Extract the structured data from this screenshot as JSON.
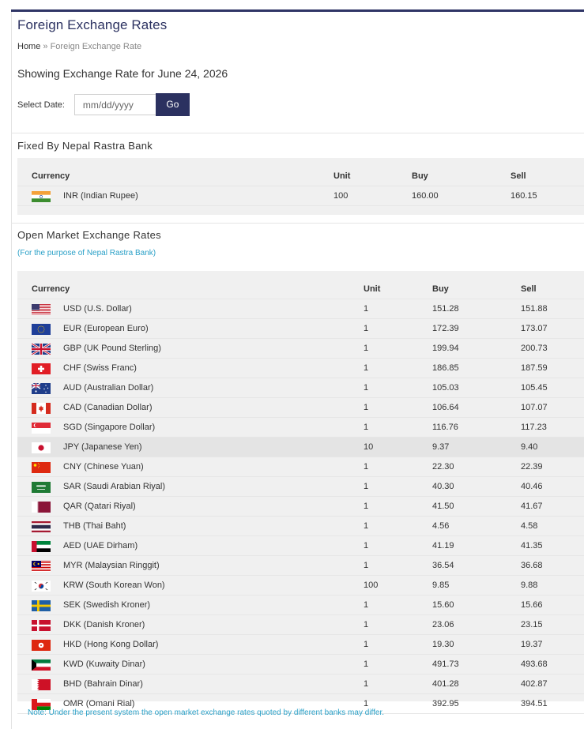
{
  "page": {
    "title": "Foreign Exchange Rates",
    "breadcrumb_home": "Home",
    "breadcrumb_sep": " » ",
    "breadcrumb_current": "Foreign Exchange Rate",
    "showing": "Showing Exchange Rate for June 24, 2026",
    "select_date_label": "Select Date:",
    "date_placeholder": "mm/dd/yyyy",
    "go_label": "Go"
  },
  "fixed": {
    "title": "Fixed By Nepal Rastra Bank",
    "headers": {
      "currency": "Currency",
      "unit": "Unit",
      "buy": "Buy",
      "sell": "Sell"
    },
    "rows": [
      {
        "flag": "india-flag-icon",
        "currency": "INR (Indian Rupee)",
        "unit": "100",
        "buy": "160.00",
        "sell": "160.15"
      }
    ]
  },
  "open": {
    "title": "Open Market Exchange Rates",
    "subtitle": "(For the purpose of Nepal Rastra Bank)",
    "headers": {
      "currency": "Currency",
      "unit": "Unit",
      "buy": "Buy",
      "sell": "Sell"
    },
    "rows": [
      {
        "flag": "usa-flag-icon",
        "currency": "USD (U.S. Dollar)",
        "unit": "1",
        "buy": "151.28",
        "sell": "151.88"
      },
      {
        "flag": "eu-flag-icon",
        "currency": "EUR (European Euro)",
        "unit": "1",
        "buy": "172.39",
        "sell": "173.07"
      },
      {
        "flag": "uk-flag-icon",
        "currency": "GBP (UK Pound Sterling)",
        "unit": "1",
        "buy": "199.94",
        "sell": "200.73"
      },
      {
        "flag": "switzerland-flag-icon",
        "currency": "CHF (Swiss Franc)",
        "unit": "1",
        "buy": "186.85",
        "sell": "187.59"
      },
      {
        "flag": "australia-flag-icon",
        "currency": "AUD (Australian Dollar)",
        "unit": "1",
        "buy": "105.03",
        "sell": "105.45"
      },
      {
        "flag": "canada-flag-icon",
        "currency": "CAD (Canadian Dollar)",
        "unit": "1",
        "buy": "106.64",
        "sell": "107.07"
      },
      {
        "flag": "singapore-flag-icon",
        "currency": "SGD (Singapore Dollar)",
        "unit": "1",
        "buy": "116.76",
        "sell": "117.23"
      },
      {
        "flag": "japan-flag-icon",
        "currency": "JPY (Japanese Yen)",
        "unit": "10",
        "buy": "9.37",
        "sell": "9.40",
        "highlight": true
      },
      {
        "flag": "china-flag-icon",
        "currency": "CNY (Chinese Yuan)",
        "unit": "1",
        "buy": "22.30",
        "sell": "22.39"
      },
      {
        "flag": "saudi-flag-icon",
        "currency": "SAR (Saudi Arabian Riyal)",
        "unit": "1",
        "buy": "40.30",
        "sell": "40.46"
      },
      {
        "flag": "qatar-flag-icon",
        "currency": "QAR (Qatari Riyal)",
        "unit": "1",
        "buy": "41.50",
        "sell": "41.67"
      },
      {
        "flag": "thailand-flag-icon",
        "currency": "THB (Thai Baht)",
        "unit": "1",
        "buy": "4.56",
        "sell": "4.58"
      },
      {
        "flag": "uae-flag-icon",
        "currency": "AED (UAE Dirham)",
        "unit": "1",
        "buy": "41.19",
        "sell": "41.35"
      },
      {
        "flag": "malaysia-flag-icon",
        "currency": "MYR (Malaysian Ringgit)",
        "unit": "1",
        "buy": "36.54",
        "sell": "36.68"
      },
      {
        "flag": "south-korea-flag-icon",
        "currency": "KRW (South Korean Won)",
        "unit": "100",
        "buy": "9.85",
        "sell": "9.88"
      },
      {
        "flag": "sweden-flag-icon",
        "currency": "SEK (Swedish Kroner)",
        "unit": "1",
        "buy": "15.60",
        "sell": "15.66"
      },
      {
        "flag": "denmark-flag-icon",
        "currency": "DKK (Danish Kroner)",
        "unit": "1",
        "buy": "23.06",
        "sell": "23.15"
      },
      {
        "flag": "hong-kong-flag-icon",
        "currency": "HKD (Hong Kong Dollar)",
        "unit": "1",
        "buy": "19.30",
        "sell": "19.37"
      },
      {
        "flag": "kuwait-flag-icon",
        "currency": "KWD (Kuwaity Dinar)",
        "unit": "1",
        "buy": "491.73",
        "sell": "493.68"
      },
      {
        "flag": "bahrain-flag-icon",
        "currency": "BHD (Bahrain Dinar)",
        "unit": "1",
        "buy": "401.28",
        "sell": "402.87"
      },
      {
        "flag": "oman-flag-icon",
        "currency": "OMR (Omani Rial)",
        "unit": "1",
        "buy": "392.95",
        "sell": "394.51"
      }
    ]
  },
  "note": "Note: Under the present system the open market exchange rates quoted by different banks may differ.",
  "colors": {
    "primary": "#2b3160",
    "accent_link": "#2aa0c7",
    "table_bg": "#f0f0f0",
    "highlight_row": "#e4e4e4"
  }
}
